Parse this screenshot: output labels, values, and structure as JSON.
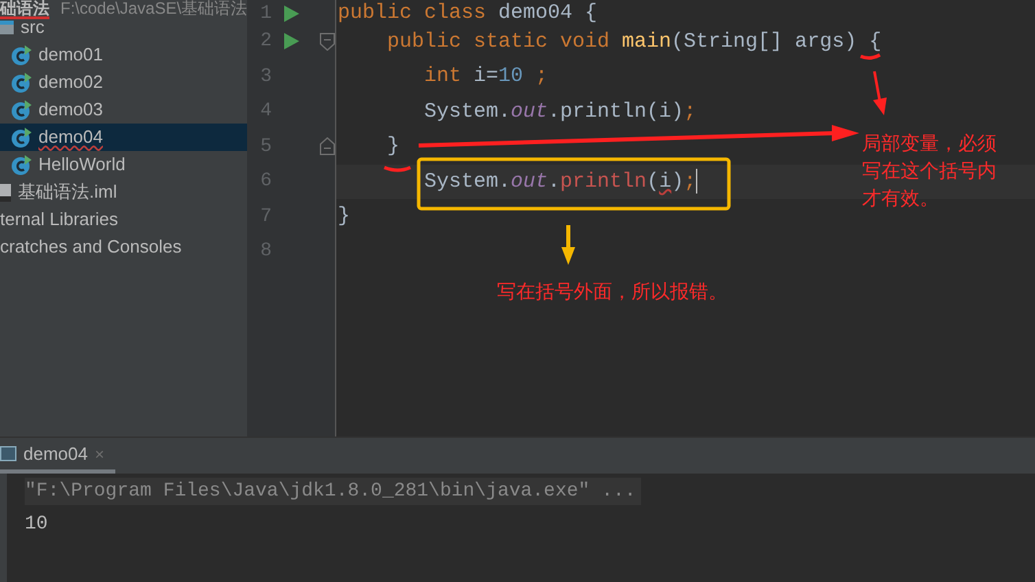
{
  "project_header": {
    "name": "础语法",
    "path": "F:\\code\\JavaSE\\基础语法",
    "error": true
  },
  "project_tree": [
    {
      "label": "src",
      "kind": "folder",
      "selected": false,
      "error": false,
      "children": [
        {
          "label": "demo01",
          "kind": "class",
          "selected": false,
          "error": false
        },
        {
          "label": "demo02",
          "kind": "class",
          "selected": false,
          "error": false
        },
        {
          "label": "demo03",
          "kind": "class",
          "selected": false,
          "error": false
        },
        {
          "label": "demo04",
          "kind": "class",
          "selected": true,
          "error": true
        },
        {
          "label": "HelloWorld",
          "kind": "class",
          "selected": false,
          "error": false
        }
      ]
    },
    {
      "label": "基础语法.iml",
      "kind": "file",
      "selected": false,
      "error": false
    },
    {
      "label": "ternal Libraries",
      "kind": "plain",
      "selected": false,
      "error": false
    },
    {
      "label": "cratches and Consoles",
      "kind": "plain",
      "selected": false,
      "error": false
    }
  ],
  "editor": {
    "lines": [
      {
        "number": "1",
        "current": false,
        "gutter": [
          {
            "kind": "run"
          }
        ],
        "tokens": [
          {
            "text": "public class ",
            "kind": "keyword"
          },
          {
            "text": "demo04 {",
            "kind": "plain"
          }
        ],
        "children": [
          {
            "number": "2",
            "current": false,
            "gutter": [
              {
                "kind": "run"
              },
              {
                "kind": "fold_start"
              }
            ],
            "tokens": [
              {
                "text": "public static void ",
                "kind": "keyword"
              },
              {
                "text": "main",
                "kind": "method"
              },
              {
                "text": "(String[] args) {",
                "kind": "plain"
              }
            ],
            "children": [
              {
                "number": "3",
                "current": false,
                "tokens": [
                  {
                    "text": "int ",
                    "kind": "keyword"
                  },
                  {
                    "text": "i=",
                    "kind": "plain"
                  },
                  {
                    "text": "10",
                    "kind": "number"
                  },
                  {
                    "text": " ;",
                    "kind": "keyword"
                  }
                ]
              },
              {
                "number": "4",
                "current": false,
                "tokens": [
                  {
                    "text": "System.",
                    "kind": "plain"
                  },
                  {
                    "text": "out",
                    "kind": "field"
                  },
                  {
                    "text": ".println(i)",
                    "kind": "plain"
                  },
                  {
                    "text": ";",
                    "kind": "keyword"
                  }
                ]
              }
            ]
          },
          {
            "number": "5",
            "current": false,
            "gutter": [
              {
                "kind": "fold_end"
              }
            ],
            "tokens": [
              {
                "text": "}",
                "kind": "plain"
              }
            ],
            "children": [
              {
                "number": "6",
                "current": true,
                "tokens": [
                  {
                    "text": "System.",
                    "kind": "plain"
                  },
                  {
                    "text": "out",
                    "kind": "field"
                  },
                  {
                    "text": ".",
                    "kind": "plain"
                  },
                  {
                    "text": "println",
                    "kind": "error_method"
                  },
                  {
                    "text": "(",
                    "kind": "plain"
                  },
                  {
                    "text": "i",
                    "kind": "error_ident"
                  },
                  {
                    "text": ")",
                    "kind": "plain"
                  },
                  {
                    "text": ";",
                    "kind": "keyword"
                  }
                ]
              }
            ]
          }
        ]
      },
      {
        "number": "7",
        "current": false,
        "tokens": [
          {
            "text": "}",
            "kind": "plain"
          }
        ]
      },
      {
        "number": "8",
        "current": false
      }
    ]
  },
  "annotations": [
    {
      "text": "局部变量，必须写在这个括号内才有效。",
      "kind": "inside_note"
    },
    {
      "text": "写在括号外面，所以报错。",
      "kind": "outside_note"
    }
  ],
  "run_panel": {
    "tab": {
      "label": "demo04",
      "selected": true,
      "close": "×"
    },
    "console": [
      {
        "text": "\"F:\\Program Files\\Java\\jdk1.8.0_281\\bin\\java.exe\" ...",
        "kind": "command"
      },
      {
        "text": "10",
        "kind": "output"
      }
    ]
  }
}
